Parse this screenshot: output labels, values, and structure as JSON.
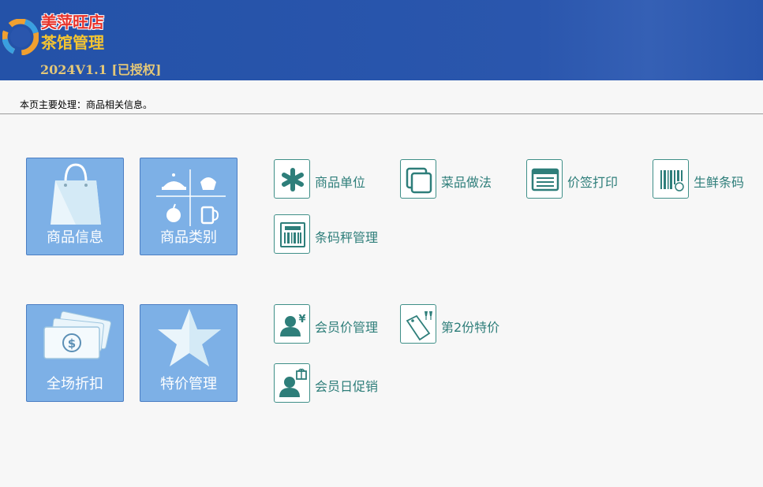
{
  "header": {
    "brand_name": "美萍旺店",
    "brand_sub": "茶馆管理",
    "version": "2024V1.1 [已授权]"
  },
  "description": "本页主要处理：商品相关信息。",
  "big_tiles": [
    {
      "label": "商品信息",
      "icon": "shopping-bag-icon"
    },
    {
      "label": "商品类别",
      "icon": "category-grid-icon"
    },
    {
      "label": "全场折扣",
      "icon": "money-icon"
    },
    {
      "label": "特价管理",
      "icon": "star-icon"
    }
  ],
  "small_items": [
    {
      "label": "商品单位",
      "icon": "asterisk-icon"
    },
    {
      "label": "菜品做法",
      "icon": "copy-squares-icon"
    },
    {
      "label": "价签打印",
      "icon": "price-tag-list-icon"
    },
    {
      "label": "生鲜条码",
      "icon": "barcode-kg-icon"
    },
    {
      "label": "条码秤管理",
      "icon": "sale-barcode-icon"
    },
    {
      "label": "会员价管理",
      "icon": "member-yen-icon"
    },
    {
      "label": "第2份特价",
      "icon": "sale-tag-icon"
    },
    {
      "label": "会员日促销",
      "icon": "member-gift-icon"
    }
  ],
  "colors": {
    "header_bg": "#2a56ad",
    "tile_bg": "#7db0e6",
    "teal": "#2e7e7a",
    "brand_red": "#e8322a",
    "brand_gold": "#f4c431"
  }
}
